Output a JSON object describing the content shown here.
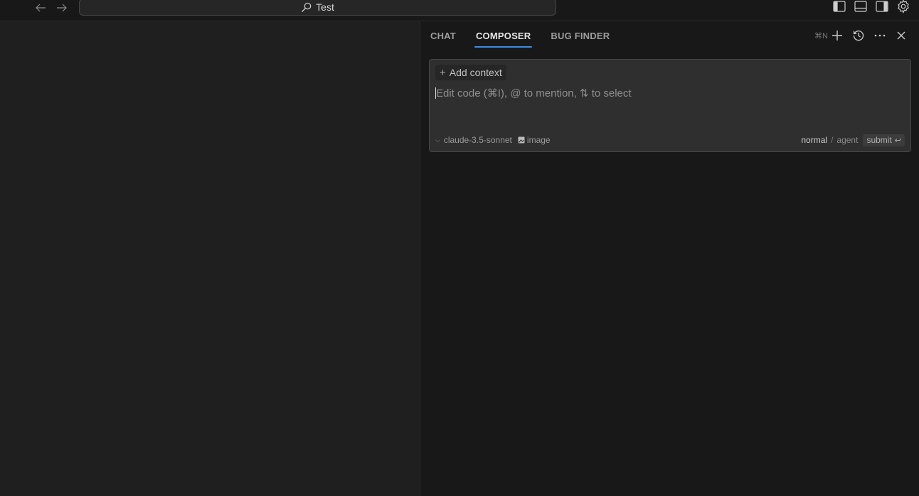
{
  "titlebar": {
    "search_text": "Test",
    "icons": [
      "arrow-left-icon",
      "arrow-right-icon",
      "search-icon",
      "toggle-primary-sidebar-icon",
      "toggle-panel-icon",
      "toggle-secondary-sidebar-icon",
      "gear-icon"
    ]
  },
  "panel": {
    "tabs": [
      {
        "label": "CHAT",
        "active": false
      },
      {
        "label": "COMPOSER",
        "active": true
      },
      {
        "label": "BUG FINDER",
        "active": false
      }
    ],
    "new_shortcut": "⌘N",
    "action_icons": [
      "plus-icon",
      "history-icon",
      "more-icon",
      "close-icon"
    ]
  },
  "composer": {
    "add_context_label": "Add context",
    "placeholder": "Edit code (⌘I), @ to mention, ⇅ to select",
    "value": "",
    "model": "claude-3.5-sonnet",
    "image_label": "image",
    "mode_normal": "normal",
    "mode_separator": "/",
    "mode_agent": "agent",
    "submit_label": "submit",
    "submit_key": "↩"
  },
  "colors": {
    "accent": "#3b8eea",
    "panel_bg": "#181818",
    "editor_bg": "#1f1f1f",
    "composer_bg": "#2f2f2f"
  }
}
